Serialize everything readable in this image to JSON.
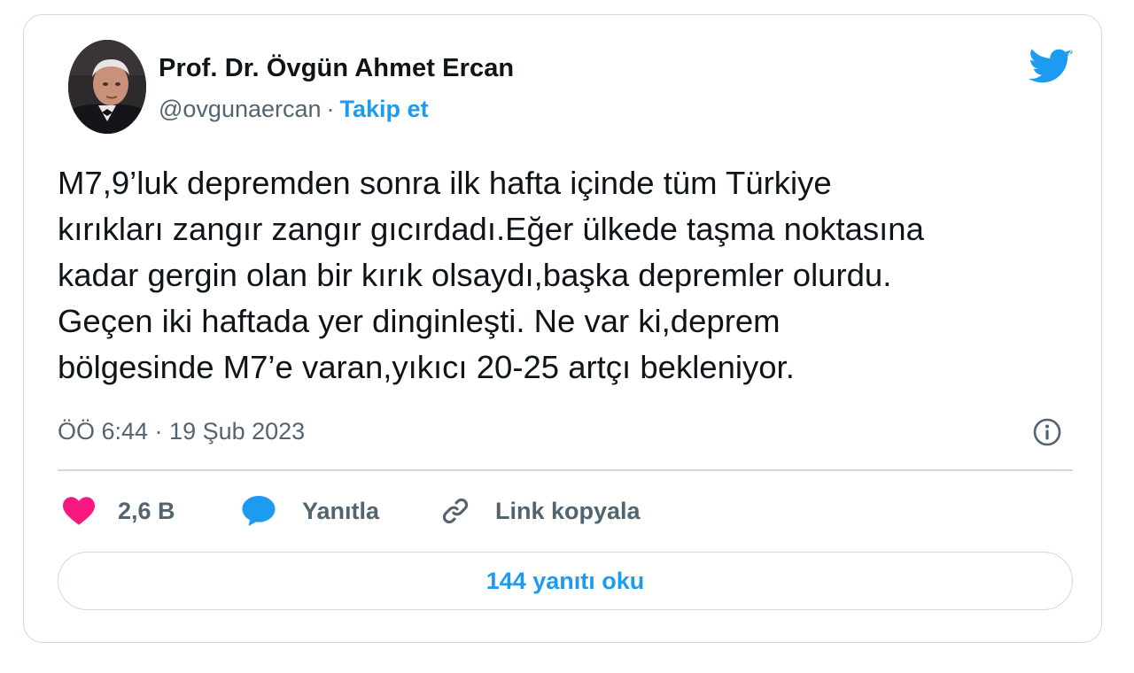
{
  "author": {
    "name": "Prof. Dr. Övgün Ahmet Ercan",
    "handle": "@ovgunaercan",
    "separator": "·",
    "follow_label": "Takip et"
  },
  "tweet": {
    "lines": [
      "M7,9’luk depremden sonra ilk hafta içinde tüm Türkiye",
      "kırıkları zangır zangır gıcırdadı.Eğer ülkede taşma noktasına",
      "kadar gergin olan bir kırık olsaydı,başka depremler olurdu.",
      "Geçen iki haftada yer dinginleşti. Ne var ki,deprem",
      "bölgesinde M7’e varan,yıkıcı 20-25 artçı bekleniyor."
    ],
    "timestamp": "ÖÖ 6:44 · 19 Şub 2023"
  },
  "actions": {
    "likes_count": "2,6 B",
    "reply_label": "Yanıtla",
    "copy_link_label": "Link kopyala"
  },
  "read_replies_label": "144 yanıtı oku",
  "icons": {
    "brand": "twitter-bird-icon",
    "info": "info-icon",
    "like": "heart-icon",
    "reply": "speech-bubble-icon",
    "link": "link-icon"
  },
  "colors": {
    "accent": "#1d9bf0",
    "heart": "#f91880",
    "text": "#0f1419",
    "secondary_text": "#536471",
    "border": "#cfd9de"
  }
}
